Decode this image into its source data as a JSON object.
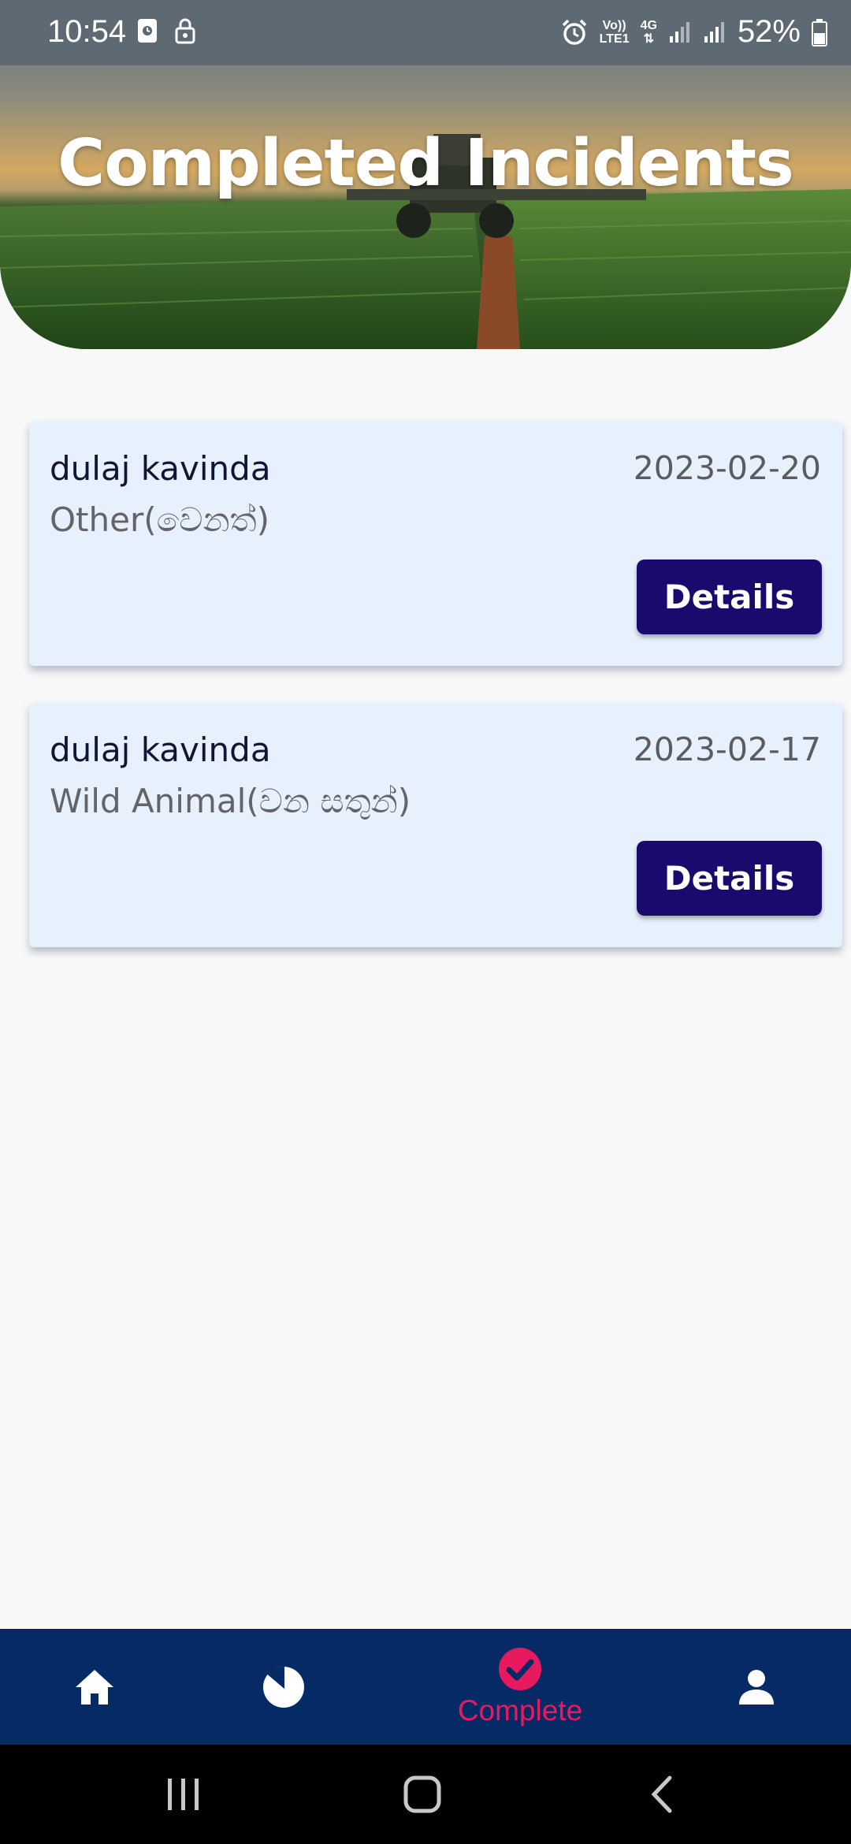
{
  "status_bar": {
    "time": "10:54",
    "volte_top": "Vo))",
    "volte_bottom": "LTE1",
    "network": "4G",
    "battery": "52%"
  },
  "header": {
    "title": "Completed Incidents"
  },
  "incidents": [
    {
      "name": "dulaj kavinda",
      "date": "2023-02-20",
      "type": "Other(වෙනත්)",
      "button_label": "Details"
    },
    {
      "name": "dulaj kavinda",
      "date": "2023-02-17",
      "type": "Wild Animal(වන සතුන්)",
      "button_label": "Details"
    }
  ],
  "bottom_nav": {
    "items": [
      {
        "icon": "home-icon",
        "label": ""
      },
      {
        "icon": "pie-chart-icon",
        "label": ""
      },
      {
        "icon": "check-circle-icon",
        "label": "Complete",
        "active": true
      },
      {
        "icon": "person-icon",
        "label": ""
      }
    ],
    "active_color": "#e8195e",
    "background": "#062a66"
  },
  "colors": {
    "card_background": "#e7f1fd",
    "button_background": "#1a0a6e"
  }
}
